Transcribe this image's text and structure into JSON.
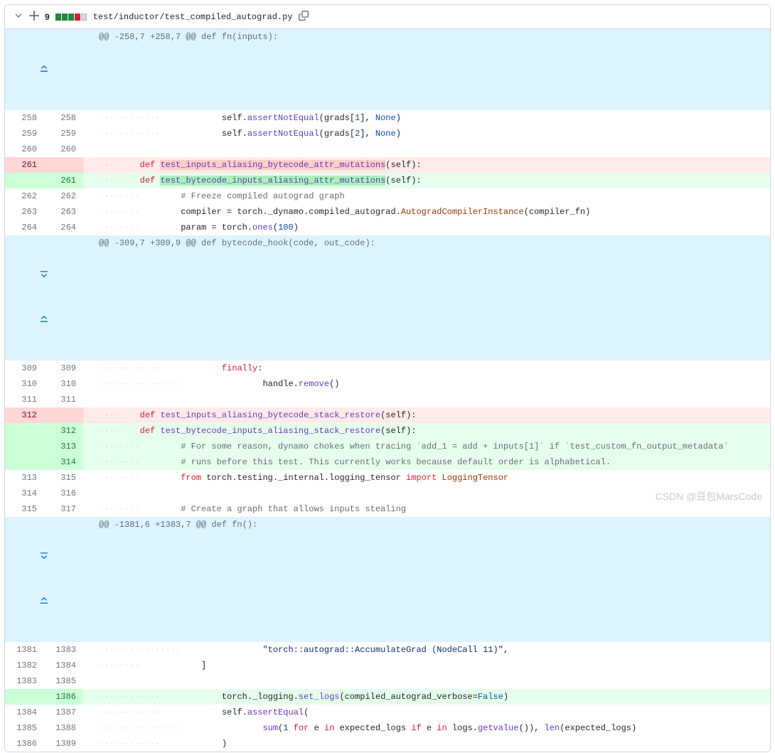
{
  "file": {
    "change_count": "9",
    "path": "test/inductor/test_compiled_autograd.py"
  },
  "hunks": {
    "h1": "@@ -258,7 +258,7 @@ def fn(inputs):",
    "h2": "@@ -309,7 +309,9 @@ def bytecode_hook(code, out_code):",
    "h3": "@@ -1381,6 +1383,7 @@ def fn():"
  },
  "ln": {
    "o_258": "258",
    "n_258": "258",
    "o_259": "259",
    "n_259": "259",
    "o_260": "260",
    "n_260": "260",
    "o_261": "261",
    "n_261": "261",
    "o_262": "262",
    "n_262": "262",
    "o_263": "263",
    "n_263": "263",
    "o_264": "264",
    "n_264": "264",
    "o_309": "309",
    "n_309": "309",
    "o_310": "310",
    "n_310": "310",
    "o_311": "311",
    "n_311": "311",
    "o_312": "312",
    "n_312": "312",
    "n_313": "313",
    "n_314": "314",
    "o_313": "313",
    "n_315": "315",
    "o_314": "314",
    "n_316": "316",
    "o_315": "315",
    "n_317": "317",
    "o_1381": "1381",
    "n_1383": "1383",
    "o_1382": "1382",
    "n_1384": "1384",
    "o_1383": "1383",
    "n_1385": "1385",
    "n_1386": "1386",
    "o_1384": "1384",
    "n_1387": "1387",
    "o_1385": "1385",
    "n_1388": "1388",
    "o_1386": "1386",
    "n_1389": "1389"
  },
  "code": {
    "c258a": "            self.",
    "c258b": "assertNotEqual",
    "c258c": "(grads[",
    "c258d": "1",
    "c258e": "], ",
    "c258f": "None",
    "c258g": ")",
    "c259a": "            self.",
    "c259b": "assertNotEqual",
    "c259c": "(grads[",
    "c259d": "2",
    "c259e": "], ",
    "c259f": "None",
    "c259g": ")",
    "c261ws": "    ",
    "c261k": "def",
    "c261sp": " ",
    "c261del": "test_inputs_aliasing_bytecode_attr_mutations",
    "c261add": "test_bytecode_inputs_aliasing_attr_mutations",
    "c261tail": "(self):",
    "c262": "        # Freeze compiled autograd graph",
    "c263a": "        compiler = torch._dynamo.compiled_autograd.",
    "c263b": "AutogradCompilerInstance",
    "c263c": "(compiler_fn)",
    "c264a": "        param = torch.",
    "c264b": "ones",
    "c264c": "(",
    "c264d": "100",
    "c264e": ")",
    "c309a": "            ",
    "c309b": "finally",
    "c310a": "                handle.",
    "c310b": "remove",
    "c310c": "()",
    "c312ws": "    ",
    "c312k": "def",
    "c312sp": " ",
    "c312del": "test_inputs_aliasing_bytecode_stack_restore",
    "c312add": "test_bytecode_inputs_aliasing_stack_restore",
    "c312tail": "(self):",
    "c313": "        # For some reason, dynamo chokes when tracing `add_1 = add + inputs[1]` if `test_custom_fn_output_metadata`",
    "c314": "        # runs before this test. This currently works because default order is alphabetical.",
    "c315a": "        ",
    "c315b": "from",
    "c315c": " torch.testing._internal.logging_tensor ",
    "c315d": "import",
    "c315e": " LoggingTensor",
    "c317": "        # Create a graph that allows inputs stealing",
    "c1381a": "                ",
    "c1381b": "\"torch::autograd::AccumulateGrad (NodeCall 11)\"",
    "c1381c": ",",
    "c1382": "            ]",
    "c1386a": "            torch._logging.",
    "c1386b": "set_logs",
    "c1386c": "(compiled_autograd_verbose=",
    "c1386d": "False",
    "c1386e": ")",
    "c1387a": "            self.",
    "c1387b": "assertEqual",
    "c1387c": "(",
    "c1388a": "                ",
    "c1388b": "sum",
    "c1388c": "(",
    "c1388d": "1",
    "c1388e": " ",
    "c1388f": "for",
    "c1388g": " e ",
    "c1388h": "in",
    "c1388i": " expected_logs ",
    "c1388j": "if",
    "c1388k": " e ",
    "c1388l": "in",
    "c1388m": " logs.",
    "c1388n": "getvalue",
    "c1388o": "()), ",
    "c1388p": "len",
    "c1388q": "(expected_logs)",
    "c1389": "            )"
  },
  "watermark": "CSDN @豆包MarsCode"
}
